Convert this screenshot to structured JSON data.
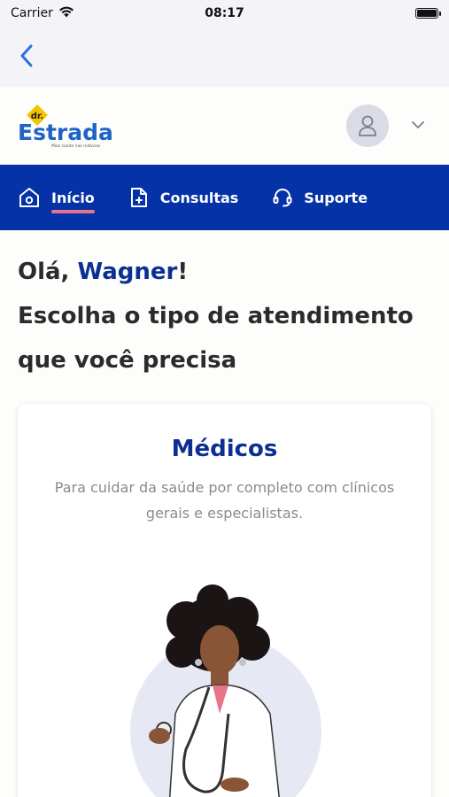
{
  "status_bar": {
    "carrier": "Carrier",
    "time": "08:17"
  },
  "header": {
    "logo_top": "dr.",
    "logo_text": "Estrada",
    "logo_tagline": "Mais saúde nas rodovias"
  },
  "tabs": [
    {
      "label": "Início",
      "icon": "home-icon",
      "active": true
    },
    {
      "label": "Consultas",
      "icon": "calendar-icon",
      "active": false
    },
    {
      "label": "Suporte",
      "icon": "headset-icon",
      "active": false
    }
  ],
  "greeting": {
    "hello": "Olá, ",
    "name": "Wagner",
    "exclaim": "!",
    "prompt": "Escolha o tipo de atendimento que você precisa"
  },
  "card": {
    "title": "Médicos",
    "description": "Para cuidar da saúde por completo com clínicos gerais e especialistas."
  },
  "colors": {
    "brand_blue": "#0632a8",
    "accent_pink": "#e8748a",
    "logo_yellow": "#f3c400"
  }
}
